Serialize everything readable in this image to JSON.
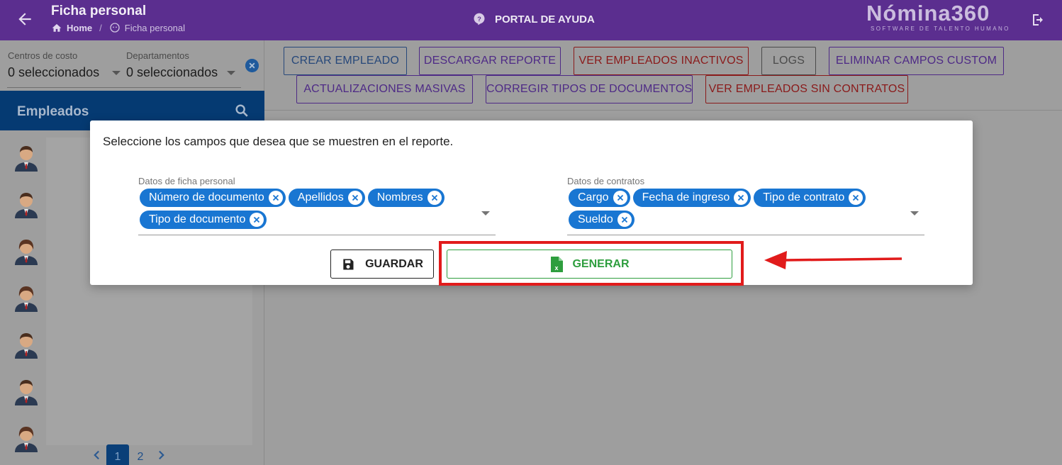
{
  "header": {
    "title": "Ficha personal",
    "breadcrumb_home": "Home",
    "breadcrumb_current": "Ficha personal",
    "help_label": "PORTAL DE AYUDA",
    "logo_main": "Nómina360",
    "logo_sub": "SOFTWARE DE TALENTO HUMANO"
  },
  "filters": {
    "cost_center_label": "Centros de costo",
    "cost_center_value": "0 seleccionados",
    "department_label": "Departamentos",
    "department_value": "0 seleccionados"
  },
  "employees": {
    "title": "Empleados",
    "pagination": {
      "current": "1",
      "next": "2"
    }
  },
  "toolbar": {
    "crear": "CREAR EMPLEADO",
    "descargar": "DESCARGAR REPORTE",
    "inactivos": "VER EMPLEADOS INACTIVOS",
    "logs": "LOGS",
    "eliminar": "ELIMINAR CAMPOS CUSTOM",
    "masivas": "ACTUALIZACIONES MASIVAS",
    "corregir": "CORREGIR TIPOS DE DOCUMENTOS",
    "sin_contratos": "VER EMPLEADOS SIN CONTRATOS"
  },
  "dialog": {
    "title": "Seleccione los campos que desea que se muestren en el reporte.",
    "personal": {
      "label": "Datos de ficha personal",
      "chips": [
        "Número de documento",
        "Apellidos",
        "Nombres",
        "Tipo de documento"
      ]
    },
    "contracts": {
      "label": "Datos de contratos",
      "chips": [
        "Cargo",
        "Fecha de ingreso",
        "Tipo de contrato",
        "Sueldo"
      ]
    },
    "save_label": "GUARDAR",
    "generate_label": "GENERAR"
  },
  "colors": {
    "header_bg": "#5b2e8f",
    "chip_bg": "#1976d2",
    "generate_green": "#2e9e3e",
    "annotation_red": "#e11b1b"
  }
}
